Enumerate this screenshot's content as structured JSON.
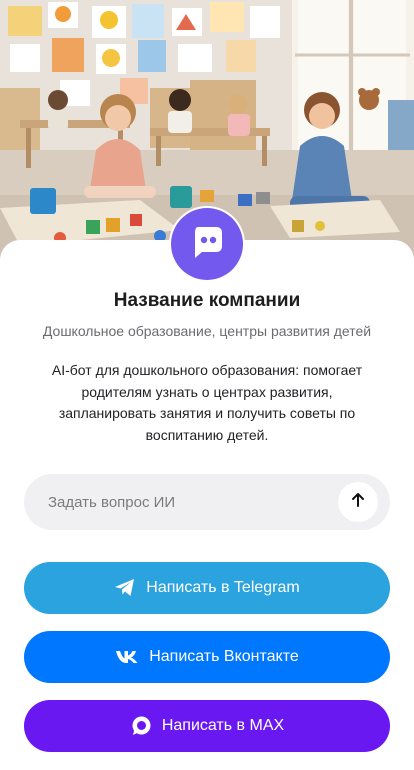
{
  "company": {
    "name": "Название компании",
    "category": "Дошкольное образование, центры развития детей",
    "description": "AI-бот для дошкольного образования: помогает родителям узнать о центрах развития, запланировать занятия и получить советы по воспитанию детей."
  },
  "ask": {
    "placeholder": "Задать вопрос ИИ",
    "send_icon": "arrow-up-icon"
  },
  "buttons": [
    {
      "label": "Написать в Telegram",
      "icon": "telegram-icon",
      "color": "#2aa3de"
    },
    {
      "label": "Написать Вконтакте",
      "icon": "vk-icon",
      "color": "#0077ff"
    },
    {
      "label": "Написать в MAX",
      "icon": "max-icon",
      "color": "#6a18f2"
    }
  ],
  "colors": {
    "avatar": "#7459ee",
    "ask_field": "#f0f0f2"
  }
}
